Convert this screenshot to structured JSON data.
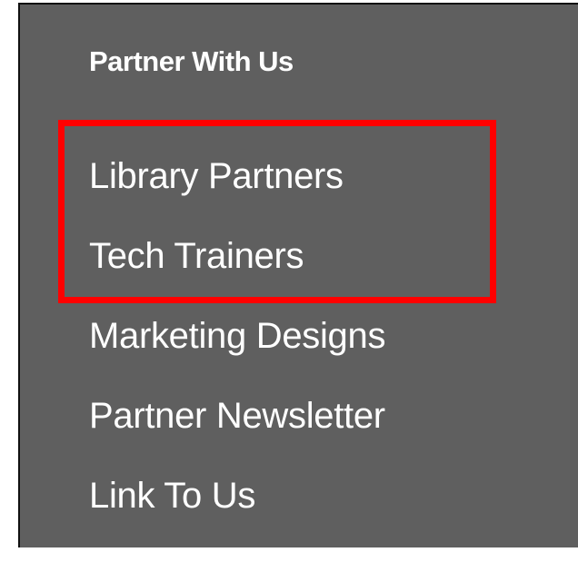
{
  "menu": {
    "heading": "Partner With Us",
    "items": [
      {
        "label": "Library Partners"
      },
      {
        "label": "Tech Trainers"
      },
      {
        "label": "Marketing Designs"
      },
      {
        "label": "Partner Newsletter"
      },
      {
        "label": "Link To Us"
      }
    ]
  },
  "colors": {
    "panel_background": "#5f5f5f",
    "text": "#ffffff",
    "highlight": "#ff0000"
  }
}
